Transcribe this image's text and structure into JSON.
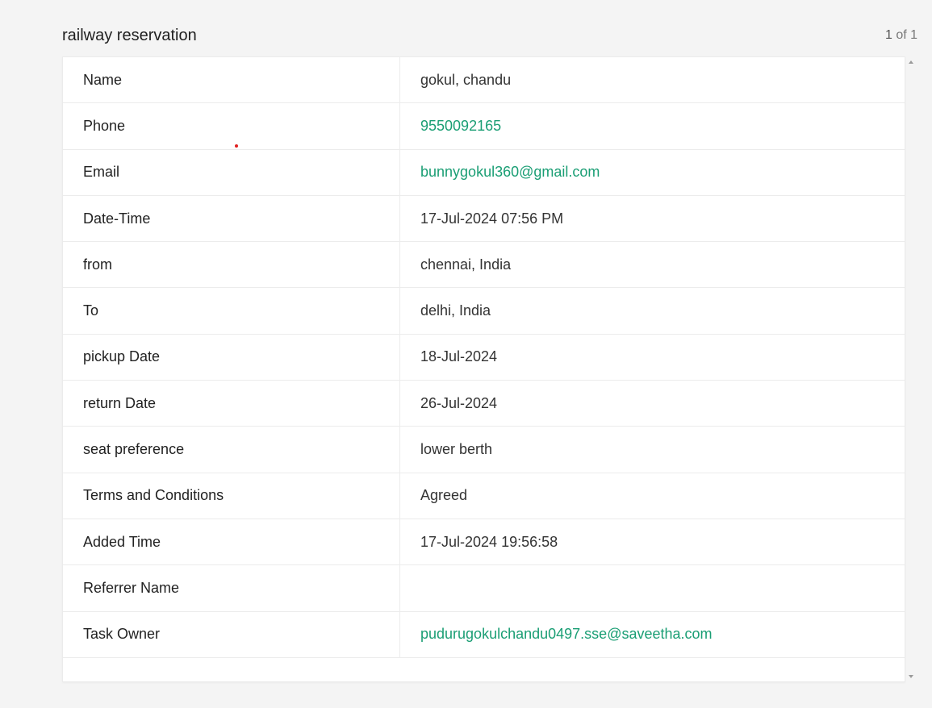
{
  "header": {
    "title": "railway reservation",
    "pager_current": "1",
    "pager_of": "of 1"
  },
  "colors": {
    "link": "#1a9e74",
    "background": "#f4f4f4"
  },
  "rows": [
    {
      "label": "Name",
      "value": "gokul, chandu",
      "link": false
    },
    {
      "label": "Phone",
      "value": "9550092165",
      "link": true
    },
    {
      "label": "Email",
      "value": "bunnygokul360@gmail.com",
      "link": true
    },
    {
      "label": "Date-Time",
      "value": "17-Jul-2024 07:56 PM",
      "link": false
    },
    {
      "label": "from",
      "value": "chennai, India",
      "link": false
    },
    {
      "label": "To",
      "value": "delhi, India",
      "link": false
    },
    {
      "label": "pickup Date",
      "value": "18-Jul-2024",
      "link": false
    },
    {
      "label": "return Date",
      "value": "26-Jul-2024",
      "link": false
    },
    {
      "label": "seat preference",
      "value": "lower berth",
      "link": false
    },
    {
      "label": "Terms and Conditions",
      "value": "Agreed",
      "link": false
    },
    {
      "label": "Added Time",
      "value": "17-Jul-2024 19:56:58",
      "link": false
    },
    {
      "label": "Referrer Name",
      "value": "",
      "link": false
    },
    {
      "label": "Task Owner",
      "value": "pudurugokulchandu0497.sse@saveetha.com",
      "link": true
    }
  ]
}
